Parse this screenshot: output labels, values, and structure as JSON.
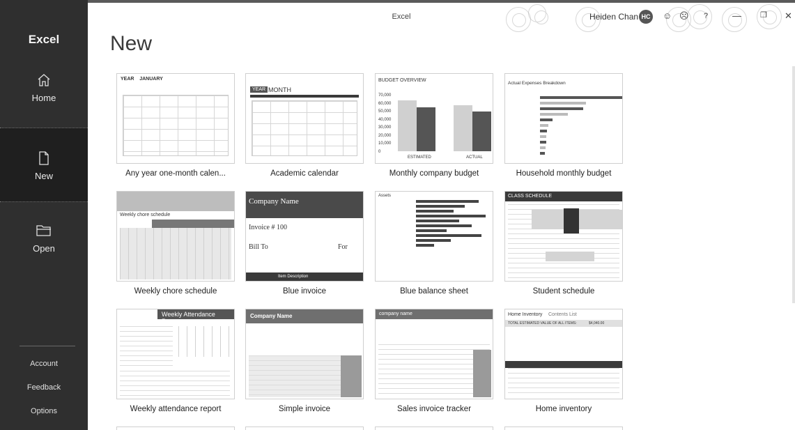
{
  "window": {
    "title": "Excel",
    "user_name": "Heiden Chan",
    "user_initials": "HC"
  },
  "titlebar_icons": [
    "smiley-icon",
    "frown-icon",
    "help-icon",
    "minimize-icon",
    "restore-icon",
    "close-icon"
  ],
  "sidebar": {
    "app_name": "Excel",
    "items": [
      {
        "label": "Home",
        "icon": "home-icon"
      },
      {
        "label": "New",
        "icon": "new-document-icon",
        "selected": true
      },
      {
        "label": "Open",
        "icon": "folder-icon"
      }
    ],
    "bottom": [
      "Account",
      "Feedback",
      "Options"
    ]
  },
  "main": {
    "title": "New",
    "templates": [
      {
        "caption": "Any year one-month calen..."
      },
      {
        "caption": "Academic calendar"
      },
      {
        "caption": "Monthly company budget"
      },
      {
        "caption": "Household monthly budget"
      },
      {
        "caption": "Weekly chore schedule"
      },
      {
        "caption": "Blue invoice"
      },
      {
        "caption": "Blue balance sheet"
      },
      {
        "caption": "Student schedule"
      },
      {
        "caption": "Weekly attendance report"
      },
      {
        "caption": "Simple invoice"
      },
      {
        "caption": "Sales invoice tracker"
      },
      {
        "caption": "Home inventory"
      }
    ],
    "thumb_text": {
      "cal_year": "YEAR",
      "cal_month": "JANUARY",
      "acad_year": "YEAR",
      "acad_month": "MONTH",
      "budget_title": "BUDGET OVERVIEW",
      "budget_estimated": "ESTIMATED",
      "budget_actual": "ACTUAL",
      "budget_yticks": [
        "70,000",
        "60,000",
        "50,000",
        "40,000",
        "30,000",
        "20,000",
        "10,000",
        "0"
      ],
      "household_title": "Actual Expenses Breakdown",
      "chore_title": "Weekly chore schedule",
      "blue_company": "Company Name",
      "blue_invoice": "Invoice # 100",
      "blue_billto": "Bill To",
      "blue_for": "For",
      "blue_item": "Item Description",
      "balance_title": "Assets",
      "student_title": "CLASS SCHEDULE",
      "attendance_title": "Weekly Attendance Report",
      "simple_company": "Company Name",
      "sales_company": "company name",
      "inventory_title": "Home Inventory",
      "inventory_tab": "Contents List",
      "inventory_total_label": "TOTAL ESTIMATED VALUE OF ALL ITEMS:",
      "inventory_total": "$4,040.00"
    }
  }
}
